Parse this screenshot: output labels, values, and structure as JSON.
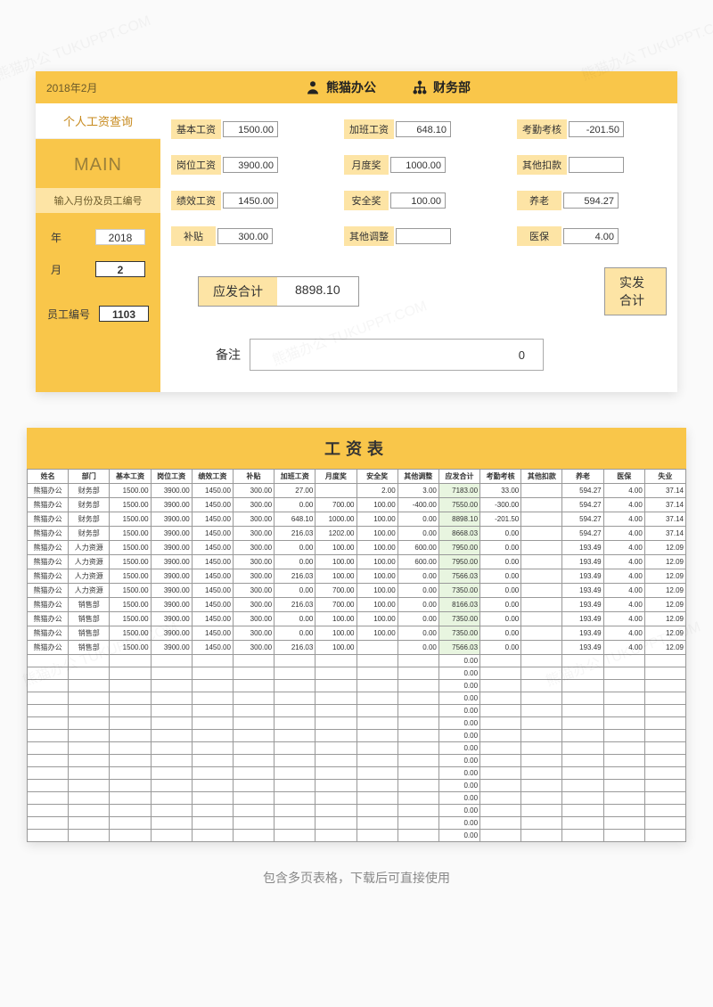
{
  "watermark": "熊猫办公 TUKUPPT.COM",
  "topcard": {
    "date": "2018年2月",
    "brand1": "熊猫办公",
    "brand2": "财务部",
    "query_tab": "个人工资查询",
    "main_title": "MAIN",
    "sub_label": "输入月份及员工编号",
    "year_label": "年",
    "year_value": "2018",
    "month_label": "月",
    "month_value": "2",
    "emp_label": "员工编号",
    "emp_value": "1103",
    "fields": {
      "r1": [
        {
          "label": "基本工资",
          "value": "1500.00"
        },
        {
          "label": "加班工资",
          "value": "648.10"
        },
        {
          "label": "考勤考核",
          "value": "-201.50"
        }
      ],
      "r2": [
        {
          "label": "岗位工资",
          "value": "3900.00"
        },
        {
          "label": "月度奖",
          "value": "1000.00"
        },
        {
          "label": "其他扣款",
          "value": ""
        }
      ],
      "r3": [
        {
          "label": "绩效工资",
          "value": "1450.00"
        },
        {
          "label": "安全奖",
          "value": "100.00"
        },
        {
          "label": "养老",
          "value": "594.27"
        }
      ],
      "r4": [
        {
          "label": "补贴",
          "value": "300.00"
        },
        {
          "label": "其他调整",
          "value": ""
        },
        {
          "label": "医保",
          "value": "4.00"
        }
      ]
    },
    "total1_label": "应发合计",
    "total1_value": "8898.10",
    "total2_label": "实发合计",
    "remark_label": "备注",
    "remark_value": "0"
  },
  "sheet": {
    "title": "工资表",
    "headers": [
      "姓名",
      "部门",
      "基本工资",
      "岗位工资",
      "绩效工资",
      "补贴",
      "加班工资",
      "月度奖",
      "安全奖",
      "其他调整",
      "应发合计",
      "考勤考核",
      "其他扣款",
      "养老",
      "医保",
      "失业"
    ],
    "rows": [
      [
        "熊猫办公",
        "财务部",
        "1500.00",
        "3900.00",
        "1450.00",
        "300.00",
        "27.00",
        "",
        "2.00",
        "3.00",
        "7183.00",
        "33.00",
        "",
        "594.27",
        "4.00",
        "37.14"
      ],
      [
        "熊猫办公",
        "财务部",
        "1500.00",
        "3900.00",
        "1450.00",
        "300.00",
        "0.00",
        "700.00",
        "100.00",
        "-400.00",
        "7550.00",
        "-300.00",
        "",
        "594.27",
        "4.00",
        "37.14"
      ],
      [
        "熊猫办公",
        "财务部",
        "1500.00",
        "3900.00",
        "1450.00",
        "300.00",
        "648.10",
        "1000.00",
        "100.00",
        "0.00",
        "8898.10",
        "-201.50",
        "",
        "594.27",
        "4.00",
        "37.14"
      ],
      [
        "熊猫办公",
        "财务部",
        "1500.00",
        "3900.00",
        "1450.00",
        "300.00",
        "216.03",
        "1202.00",
        "100.00",
        "0.00",
        "8668.03",
        "0.00",
        "",
        "594.27",
        "4.00",
        "37.14"
      ],
      [
        "熊猫办公",
        "人力资源",
        "1500.00",
        "3900.00",
        "1450.00",
        "300.00",
        "0.00",
        "100.00",
        "100.00",
        "600.00",
        "7950.00",
        "0.00",
        "",
        "193.49",
        "4.00",
        "12.09"
      ],
      [
        "熊猫办公",
        "人力资源",
        "1500.00",
        "3900.00",
        "1450.00",
        "300.00",
        "0.00",
        "100.00",
        "100.00",
        "600.00",
        "7950.00",
        "0.00",
        "",
        "193.49",
        "4.00",
        "12.09"
      ],
      [
        "熊猫办公",
        "人力资源",
        "1500.00",
        "3900.00",
        "1450.00",
        "300.00",
        "216.03",
        "100.00",
        "100.00",
        "0.00",
        "7566.03",
        "0.00",
        "",
        "193.49",
        "4.00",
        "12.09"
      ],
      [
        "熊猫办公",
        "人力资源",
        "1500.00",
        "3900.00",
        "1450.00",
        "300.00",
        "0.00",
        "700.00",
        "100.00",
        "0.00",
        "7350.00",
        "0.00",
        "",
        "193.49",
        "4.00",
        "12.09"
      ],
      [
        "熊猫办公",
        "销售部",
        "1500.00",
        "3900.00",
        "1450.00",
        "300.00",
        "216.03",
        "700.00",
        "100.00",
        "0.00",
        "8166.03",
        "0.00",
        "",
        "193.49",
        "4.00",
        "12.09"
      ],
      [
        "熊猫办公",
        "销售部",
        "1500.00",
        "3900.00",
        "1450.00",
        "300.00",
        "0.00",
        "100.00",
        "100.00",
        "0.00",
        "7350.00",
        "0.00",
        "",
        "193.49",
        "4.00",
        "12.09"
      ],
      [
        "熊猫办公",
        "销售部",
        "1500.00",
        "3900.00",
        "1450.00",
        "300.00",
        "0.00",
        "100.00",
        "100.00",
        "0.00",
        "7350.00",
        "0.00",
        "",
        "193.49",
        "4.00",
        "12.09"
      ],
      [
        "熊猫办公",
        "销售部",
        "1500.00",
        "3900.00",
        "1450.00",
        "300.00",
        "216.03",
        "100.00",
        "",
        "0.00",
        "7566.03",
        "0.00",
        "",
        "193.49",
        "4.00",
        "12.09"
      ]
    ],
    "empty_total_col": 10,
    "empty_rows": 15,
    "empty_value": "0.00"
  },
  "footer": "包含多页表格，下载后可直接使用"
}
